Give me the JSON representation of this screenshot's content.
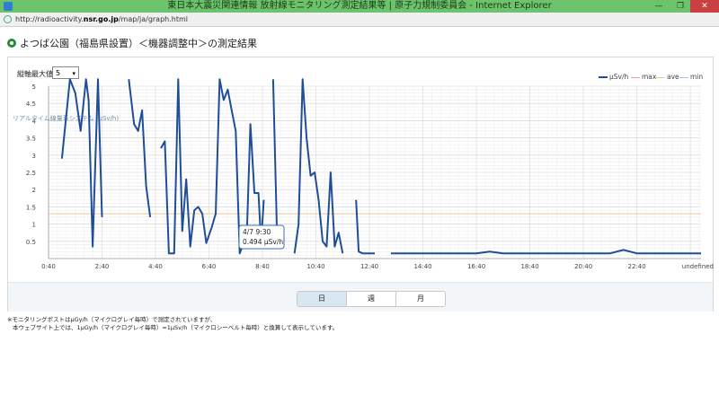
{
  "window": {
    "title": "東日本大震災関連情報 放射線モニタリング測定結果等 | 原子力規制委員会 - Internet Explorer",
    "minimize": "—",
    "restore": "❐",
    "close": "✕"
  },
  "address": {
    "url_prefix": "http://radioactivity.",
    "url_domain": "nsr.go.jp",
    "url_path": "/map/ja/graph.html"
  },
  "page": {
    "heading": "よつば公園（福島県設置）＜機器調整中＞の測定結果"
  },
  "controls": {
    "ymax_label": "縦軸最大値",
    "ymax_value": "5",
    "ymax_arrow": "▾"
  },
  "legend": [
    {
      "label": "μSv/h",
      "color": "#1f4e99"
    },
    {
      "label": "max",
      "color": "#e8a0a0"
    },
    {
      "label": "ave",
      "color": "#f0c890"
    },
    {
      "label": "min",
      "color": "#a8c8e8"
    }
  ],
  "tooltip": {
    "time": "4/7 9:30",
    "value": "0.494 μSv/h"
  },
  "tabs": [
    {
      "label": "日",
      "active": true
    },
    {
      "label": "週",
      "active": false
    },
    {
      "label": "月",
      "active": false
    }
  ],
  "notes": [
    "※モニタリングポストはμGy/h（マイクログレイ毎時）で測定されていますが、",
    "本ウェブサイト上では、1μGy/h（マイクログレイ毎時）=1μSv/h（マイクロシーベルト毎時）と換算して表示しています。"
  ],
  "chart_data": {
    "type": "line",
    "ylabel": "リアルタイム線量系システム (μSv/h)",
    "ylim": [
      0,
      5
    ],
    "yticks": [
      "5",
      "4.5",
      "4",
      "3.5",
      "3",
      "2.5",
      "2",
      "1.5",
      "1",
      "0.5"
    ],
    "xticks": [
      "0:40",
      "2:40",
      "4:40",
      "6:40",
      "8:40",
      "10:40",
      "12:40",
      "14:40",
      "16:40",
      "18:40",
      "20:40",
      "22:40",
      "undefined"
    ],
    "grid": true,
    "legend_position": "top-right",
    "series": [
      {
        "name": "μSv/h",
        "color": "#1f4e99",
        "segments": [
          [
            [
              0.5,
              2.9
            ],
            [
              0.8,
              5.2
            ],
            [
              1.0,
              4.8
            ],
            [
              1.2,
              3.7
            ],
            [
              1.4,
              5.2
            ],
            [
              1.5,
              4.6
            ],
            [
              1.65,
              0.35
            ],
            [
              1.85,
              5.2
            ],
            [
              2.0,
              1.2
            ]
          ],
          [
            [
              3.0,
              5.2
            ],
            [
              3.2,
              3.9
            ],
            [
              3.35,
              3.7
            ],
            [
              3.5,
              4.3
            ],
            [
              3.65,
              2.1
            ],
            [
              3.8,
              1.2
            ]
          ],
          [
            [
              4.2,
              3.2
            ],
            [
              4.35,
              3.4
            ],
            [
              4.5,
              0.15
            ],
            [
              4.7,
              0.15
            ],
            [
              4.85,
              5.2
            ],
            [
              5.0,
              0.8
            ],
            [
              5.15,
              2.3
            ],
            [
              5.3,
              0.35
            ],
            [
              5.45,
              1.4
            ],
            [
              5.6,
              1.5
            ],
            [
              5.75,
              1.3
            ],
            [
              5.9,
              0.45
            ],
            [
              6.1,
              0.9
            ],
            [
              6.25,
              1.3
            ],
            [
              6.4,
              5.2
            ],
            [
              6.55,
              4.6
            ],
            [
              6.7,
              4.9
            ],
            [
              6.85,
              4.3
            ],
            [
              7.0,
              3.7
            ],
            [
              7.15,
              0.15
            ],
            [
              7.25,
              0.35
            ],
            [
              7.4,
              0.35
            ],
            [
              7.55,
              3.9
            ],
            [
              7.7,
              1.9
            ],
            [
              7.85,
              1.9
            ],
            [
              7.95,
              0.45
            ],
            [
              8.05,
              1.7
            ]
          ],
          [
            [
              8.4,
              5.2
            ],
            [
              8.55,
              0.5
            ]
          ],
          [
            [
              9.2,
              0.15
            ],
            [
              9.35,
              1.0
            ],
            [
              9.5,
              5.2
            ],
            [
              9.65,
              3.5
            ],
            [
              9.8,
              2.4
            ],
            [
              9.95,
              2.5
            ],
            [
              10.1,
              1.7
            ],
            [
              10.25,
              0.5
            ],
            [
              10.4,
              0.35
            ],
            [
              10.55,
              2.5
            ],
            [
              10.7,
              0.35
            ],
            [
              10.85,
              0.75
            ],
            [
              11.0,
              0.15
            ]
          ],
          [
            [
              11.5,
              1.7
            ],
            [
              11.6,
              0.2
            ],
            [
              11.75,
              0.15
            ],
            [
              12.0,
              0.15
            ],
            [
              12.2,
              0.15
            ]
          ],
          [
            [
              12.8,
              0.15
            ],
            [
              14.0,
              0.15
            ],
            [
              16.0,
              0.15
            ],
            [
              16.5,
              0.2
            ],
            [
              17.0,
              0.15
            ],
            [
              19.0,
              0.15
            ],
            [
              21.0,
              0.15
            ],
            [
              21.5,
              0.25
            ],
            [
              22.0,
              0.15
            ],
            [
              24.0,
              0.15
            ],
            [
              24.4,
              0.15
            ]
          ]
        ]
      },
      {
        "name": "ave",
        "color": "#f0c890",
        "segments": [
          [
            [
              0.0,
              1.3
            ],
            [
              24.4,
              1.3
            ]
          ]
        ]
      }
    ]
  }
}
